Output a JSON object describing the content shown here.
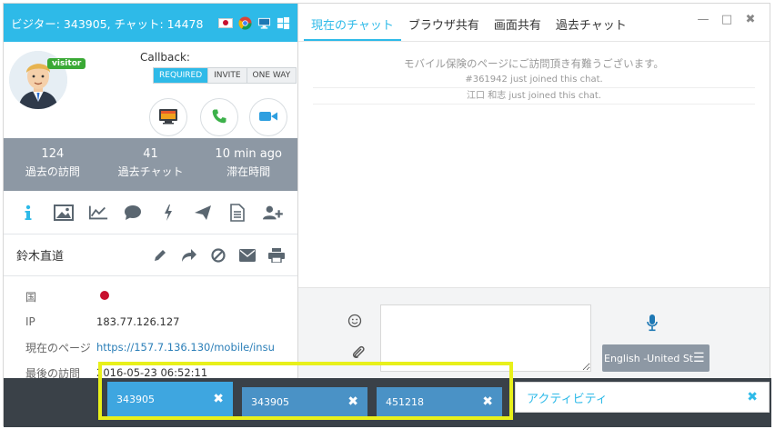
{
  "left_header": {
    "title": "ビジター: 343905, チャット: 14478",
    "icons": [
      "flag-jp-icon",
      "chrome-icon",
      "desktop-icon",
      "windows-icon"
    ]
  },
  "profile": {
    "badge": "visitor",
    "callback_label": "Callback:",
    "callback_options": [
      "REQUIRED",
      "INVITE",
      "ONE WAY"
    ],
    "callback_selected": "REQUIRED",
    "actions": [
      "screen-share-icon",
      "phone-icon",
      "video-icon"
    ]
  },
  "stats": [
    {
      "value": "124",
      "label": "過去の訪問"
    },
    {
      "value": "41",
      "label": "過去チャット"
    },
    {
      "value": "10 min ago",
      "label": "滞在時間"
    }
  ],
  "toolbar_icons": [
    "info-icon",
    "image-icon",
    "chart-icon",
    "chat-bubble-icon",
    "lightning-icon",
    "send-icon",
    "document-icon",
    "add-user-icon"
  ],
  "visitor": {
    "name": "鈴木直道",
    "actions": [
      "edit-icon",
      "forward-icon",
      "block-icon",
      "mail-icon",
      "print-icon"
    ]
  },
  "info": [
    {
      "key": "国",
      "value": ""
    },
    {
      "key": "IP",
      "value": "183.77.126.127"
    },
    {
      "key": "現在のページ",
      "value": "https://157.7.136.130/mobile/insu"
    },
    {
      "key": "最後の訪問",
      "value": "2016-05-23 06:52:11"
    }
  ],
  "tabs": [
    {
      "label": "現在のチャット",
      "active": true
    },
    {
      "label": "ブラウザ共有",
      "active": false
    },
    {
      "label": "画面共有",
      "active": false
    },
    {
      "label": "過去チャット",
      "active": false
    }
  ],
  "window_controls": [
    "minimize-icon",
    "maximize-icon",
    "close-icon"
  ],
  "chat": {
    "messages": [
      "モバイル保険のページにご訪問頂き有難うございます。",
      "#361942 just joined this chat.",
      "江口 和志 just joined this chat."
    ]
  },
  "compose": {
    "placeholder": "",
    "language": "English -United States"
  },
  "visitor_tabs": [
    {
      "label": "343905",
      "active": true
    },
    {
      "label": "343905",
      "active": false
    },
    {
      "label": "451218",
      "active": false
    }
  ],
  "activity": {
    "label": "アクティビティ"
  },
  "colors": {
    "accent": "#2ebae8",
    "stats_bg": "#8d98a4",
    "bottom_bar": "#3a4148",
    "highlight": "#e8f01a"
  }
}
